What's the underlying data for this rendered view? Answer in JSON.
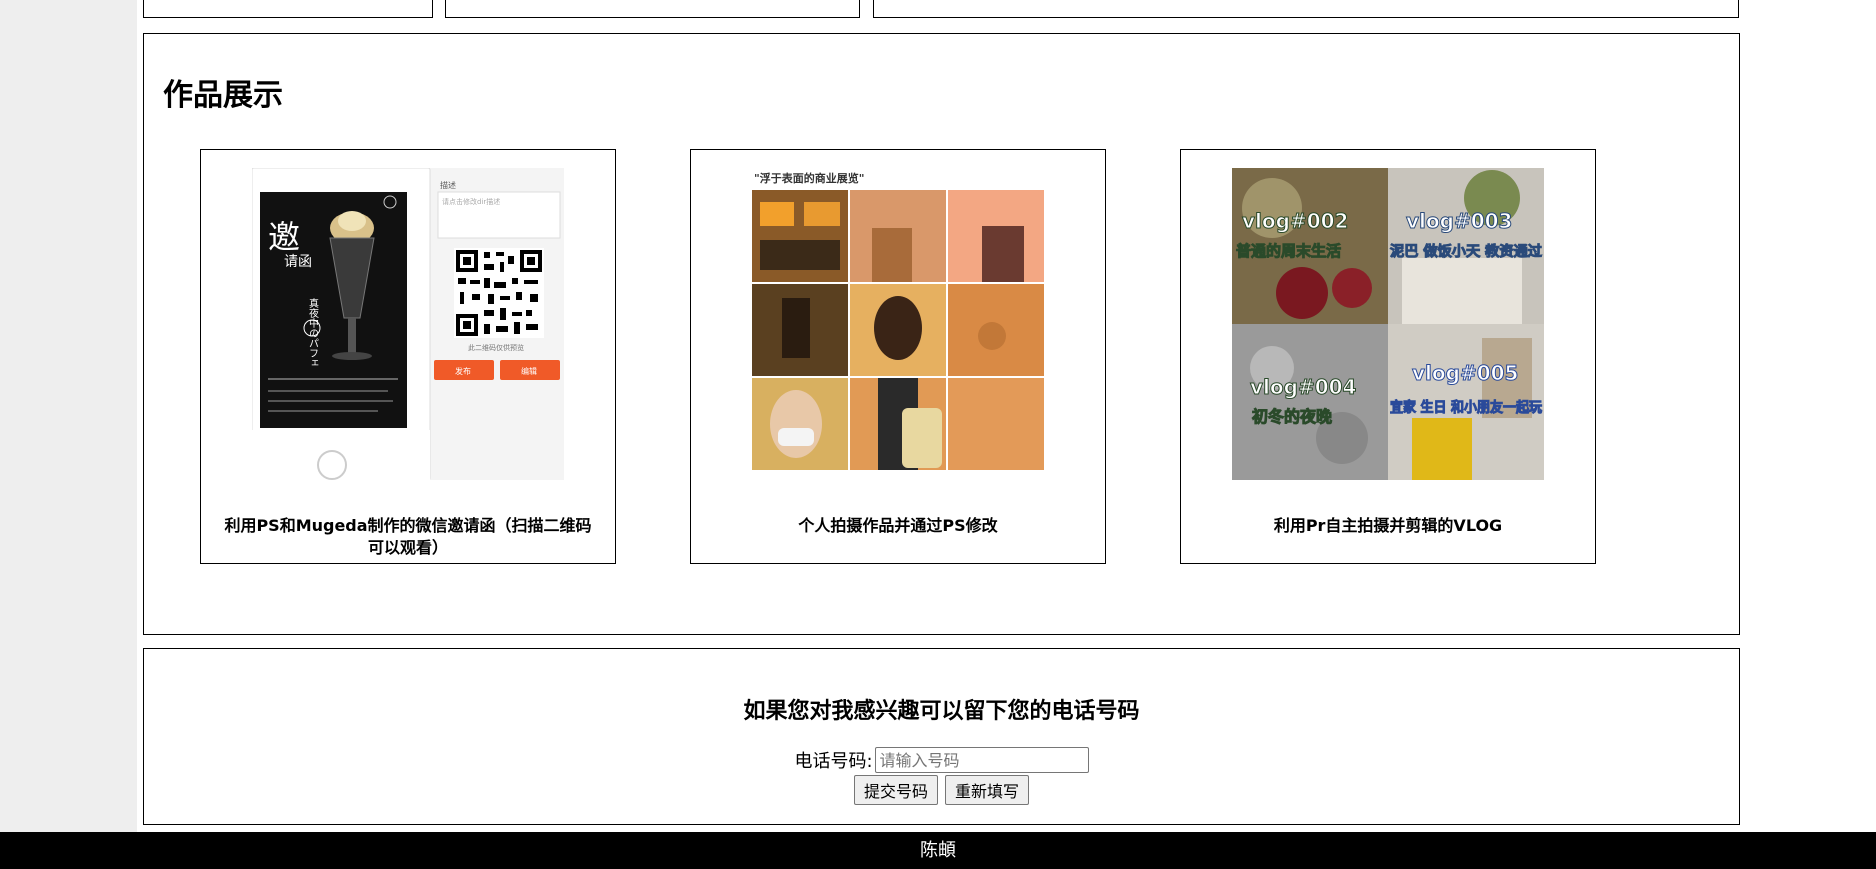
{
  "works": {
    "title": "作品展示",
    "items": [
      {
        "caption": "利用PS和Mugeda制作的微信邀请函（扫描二维码可以观看）",
        "invite_big": "邀",
        "invite_small": "请函",
        "invite_tagline": "真夜中のパフェ",
        "panel_label": "描述",
        "panel_placeholder": "请点击修改dir描述",
        "qr_note": "此二维码仅供预览",
        "publish_label": "发布",
        "edit_label": "编辑"
      },
      {
        "caption": "个人拍摄作品并通过PS修改",
        "grid_title": "\"浮于表面的商业展览\""
      },
      {
        "caption": "利用Pr自主拍摄并剪辑的VLOG",
        "tiles": [
          {
            "title": "vlog#002",
            "sub": "普通的周末生活"
          },
          {
            "title": "vlog#003",
            "sub": "泥巴 做饭小天 教资通过"
          },
          {
            "title": "vlog#004",
            "sub": "初冬的夜晚"
          },
          {
            "title": "vlog#005",
            "sub": "宜家 生日 和小朋友一起玩"
          }
        ]
      }
    ]
  },
  "contact": {
    "title": "如果您对我感兴趣可以留下您的电话号码",
    "phone_label": "电话号码:",
    "phone_placeholder": "请输入号码",
    "phone_value": "",
    "submit_label": "提交号码",
    "reset_label": "重新填写"
  },
  "footer": {
    "name": "陈頔"
  },
  "colors": {
    "page_bg": "#ffffff",
    "gutter_bg": "#eeeeee",
    "footer_bg": "#000000",
    "accent_orange": "#f05a28"
  }
}
